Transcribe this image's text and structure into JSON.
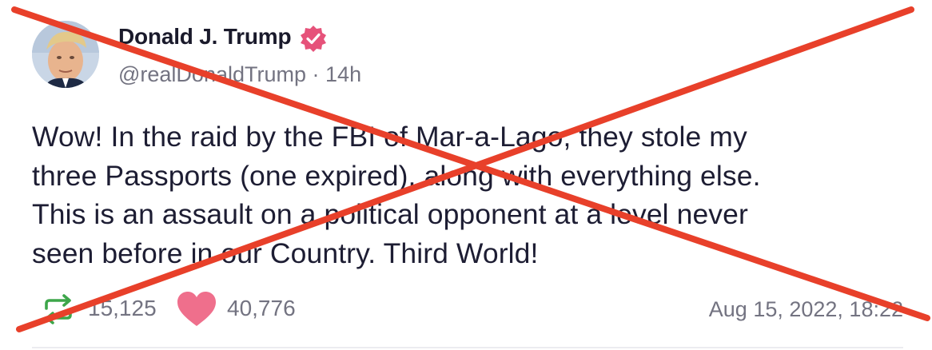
{
  "post": {
    "author_name": "Donald J. Trump",
    "handle": "@realDonaldTrump",
    "separator": "·",
    "relative_time": "14h",
    "body_lines": [
      "Wow! In the raid by the FBI of Mar-a-Lago, they stole my",
      "three Passports (one expired), along with everything else.",
      "This is an assault on a political opponent at a level never",
      "seen before in our Country. Third World!"
    ],
    "repost_count": "15,125",
    "like_count": "40,776",
    "timestamp": "Aug 15, 2022, 18:22"
  },
  "icons": {
    "avatar": "avatar-portrait",
    "verified": "verified-badge-icon",
    "repost": "repost-icon",
    "like": "heart-icon"
  },
  "colors": {
    "verified_badge": "#e6527a",
    "repost_icon": "#3da64a",
    "like_icon": "#ef6f8c",
    "cross_overlay": "#e8402a",
    "muted_text": "#737381",
    "body_text": "#1d1d33"
  }
}
